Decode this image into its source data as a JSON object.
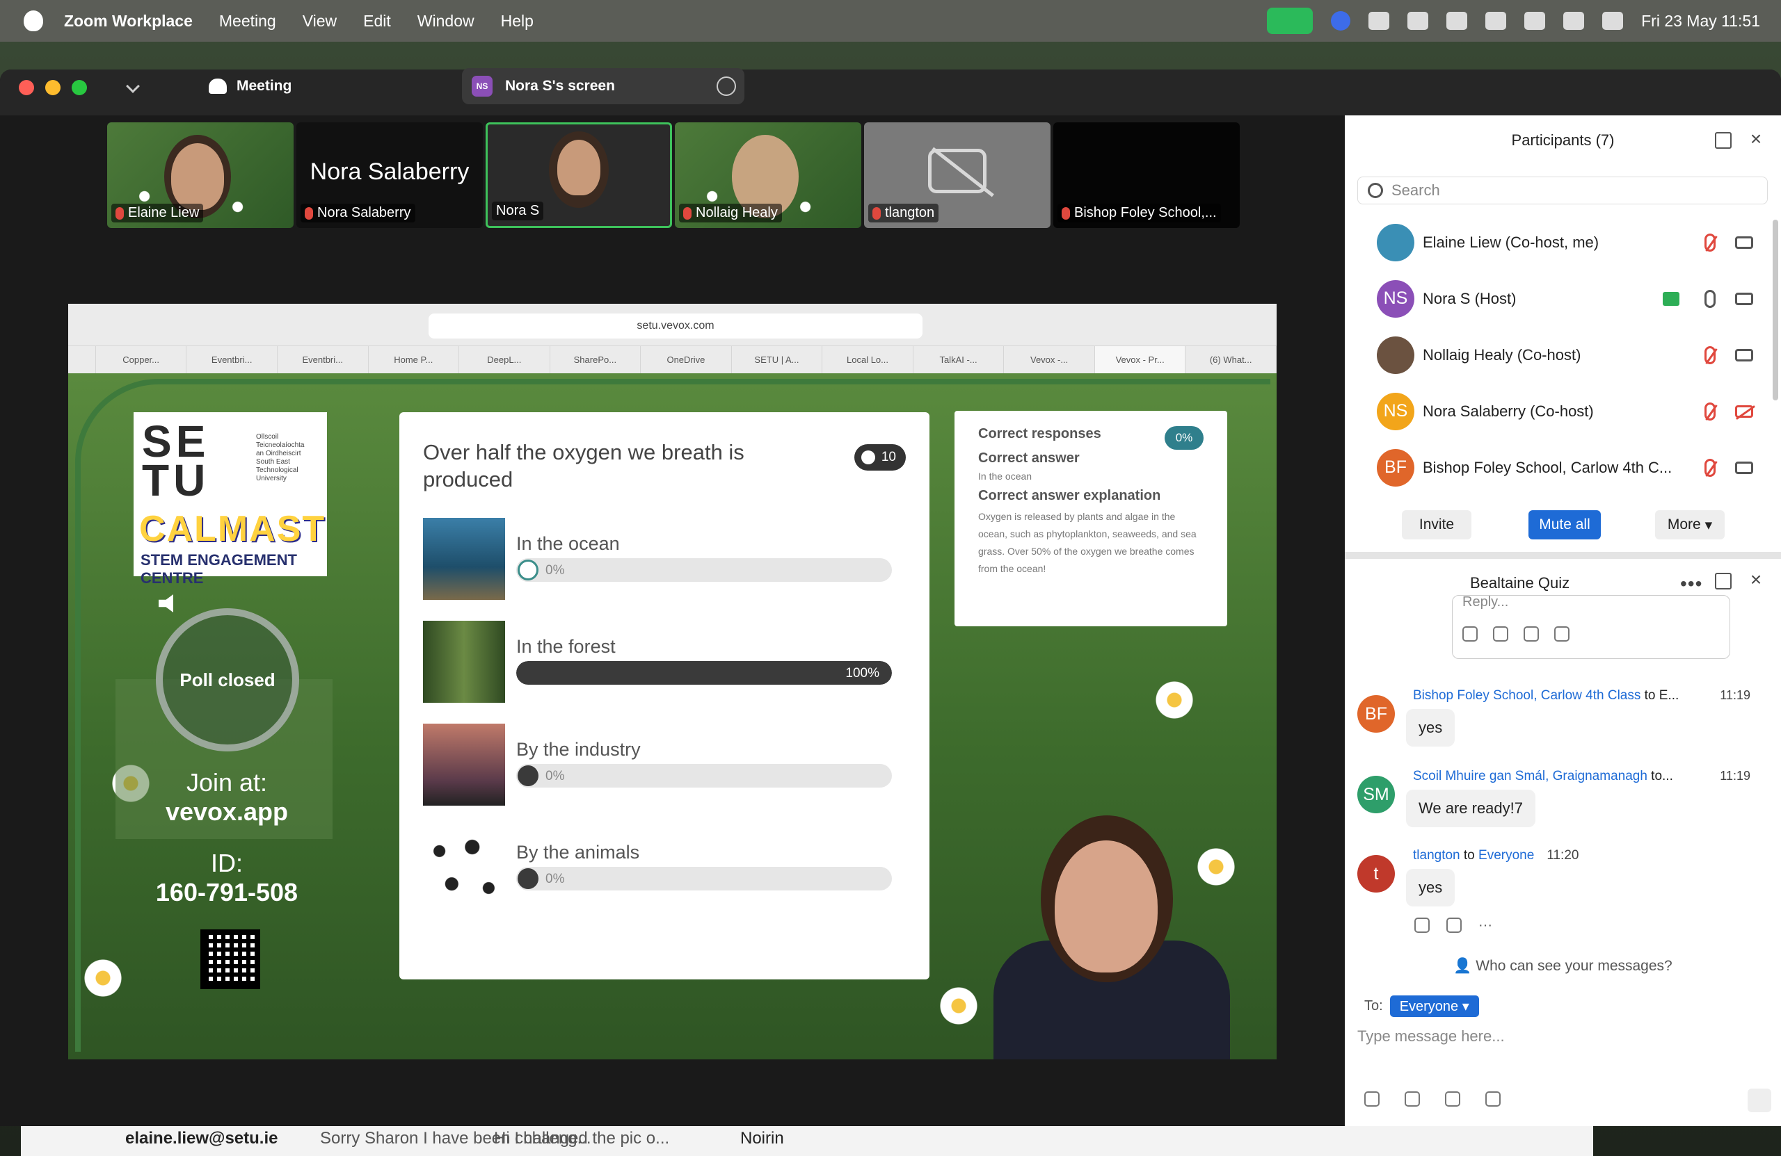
{
  "menubar": {
    "app": "Zoom Workplace",
    "items": [
      "Meeting",
      "View",
      "Edit",
      "Window",
      "Help"
    ],
    "clock": "Fri 23 May  11:51",
    "icons": [
      "zoom-video-icon",
      "zm-icon",
      "creative-cloud-icon",
      "icloud-icon",
      "outlook-icon",
      "battery-icon",
      "wifi-icon",
      "search-icon",
      "control-center-icon"
    ]
  },
  "window": {
    "meeting_label": "Meeting",
    "screen_badge": "NS",
    "screen_label": "Nora S's screen"
  },
  "video_strip": [
    {
      "name": "Elaine Liew",
      "muted": true
    },
    {
      "name": "Nora Salaberry",
      "big": "Nora Salaberry",
      "muted": true
    },
    {
      "name": "Nora S",
      "active": true
    },
    {
      "name": "Nollaig Healy",
      "muted": true
    },
    {
      "name": "tlangton",
      "muted": true,
      "camera_off": true
    },
    {
      "name": "Bishop Foley School,...",
      "muted": true
    }
  ],
  "browser": {
    "url": "setu.vevox.com",
    "tabs": [
      "Copper...",
      "Eventbri...",
      "Eventbri...",
      "Home P...",
      "DeepL...",
      "SharePo...",
      "OneDrive",
      "SETU | A...",
      "Local Lo...",
      "TalkAI -...",
      "Vevox -...",
      "Vevox - Pr...",
      "(6) What..."
    ]
  },
  "vevox": {
    "logo": {
      "setu": "SE\nTU",
      "sub": "Ollscoil Teicneolaíochta an Oirdheiscirt South East Technological University",
      "calmast": "CALMAST",
      "stem": "STEM ENGAGEMENT CENTRE"
    },
    "poll_status": "Poll closed",
    "join_at": "Join at:",
    "join_url": "vevox.app",
    "id_label": "ID:",
    "id_value": "160-791-508",
    "question": "Over half the oxygen we breath is produced",
    "count": "10",
    "options": [
      {
        "label": "In the ocean",
        "pct_text": "0%",
        "value": 0,
        "correct": true
      },
      {
        "label": "In the forest",
        "pct_text": "100%",
        "value": 1
      },
      {
        "label": "By the industry",
        "pct_text": "0%",
        "value": 0
      },
      {
        "label": "By the animals",
        "pct_text": "0%",
        "value": 0
      }
    ],
    "answer": {
      "correct_responses": "Correct responses",
      "correct_pct": "0%",
      "correct_answer": "Correct answer",
      "correct_answer_value": "In the ocean",
      "explanation_title": "Correct answer explanation",
      "explanation": "Oxygen is released by plants and algae in the ocean, such as phytoplankton, seaweeds, and sea grass. Over 50% of the oxygen we breathe comes from the ocean!"
    }
  },
  "participants": {
    "title": "Participants (7)",
    "search_placeholder": "Search",
    "list": [
      {
        "name": "Elaine Liew (Co-host, me)",
        "initials": "",
        "color": "#3a8fb5",
        "muted": true,
        "cam_off": false
      },
      {
        "name": "Nora S (Host)",
        "initials": "NS",
        "color": "#8b4fb7",
        "muted": false,
        "cam_off": false,
        "sharing": true
      },
      {
        "name": "Nollaig Healy (Co-host)",
        "initials": "",
        "color": "#6b5240",
        "muted": true,
        "cam_off": false
      },
      {
        "name": "Nora Salaberry (Co-host)",
        "initials": "NS",
        "color": "#f2a51a",
        "muted": true,
        "cam_off": true
      },
      {
        "name": "Bishop Foley School, Carlow 4th C...",
        "initials": "BF",
        "color": "#e0662a",
        "muted": true,
        "cam_off": false
      }
    ],
    "invite": "Invite",
    "mute_all": "Mute all",
    "more": "More"
  },
  "chat": {
    "title": "Bealtaine Quiz",
    "reply_placeholder": "Reply...",
    "messages": [
      {
        "initials": "BF",
        "color": "#e0662a",
        "from": "Bishop Foley School, Carlow 4th Class",
        "to": " to E...",
        "time": "11:19",
        "text": "yes"
      },
      {
        "initials": "SM",
        "color": "#2e9e6a",
        "from": "Scoil Mhuire gan Smál, Graignamanagh",
        "to": " to...",
        "time": "11:19",
        "text": "We are ready!7"
      },
      {
        "initials": "t",
        "color": "#c0392b",
        "from": "tlangton",
        "to_pre": " to ",
        "to": "Everyone",
        "time": "11:20",
        "text": "yes"
      }
    ],
    "who_can_see": "Who can see your messages?",
    "to_label": "To:",
    "to_value": "Everyone",
    "input_placeholder": "Type message here..."
  },
  "behind": {
    "email": "elaine.liew@setu.ie",
    "snippet1": "Sorry Sharon I have been challeng...",
    "snippet2": "Hi I changed the pic o...",
    "name": "Noirin"
  }
}
